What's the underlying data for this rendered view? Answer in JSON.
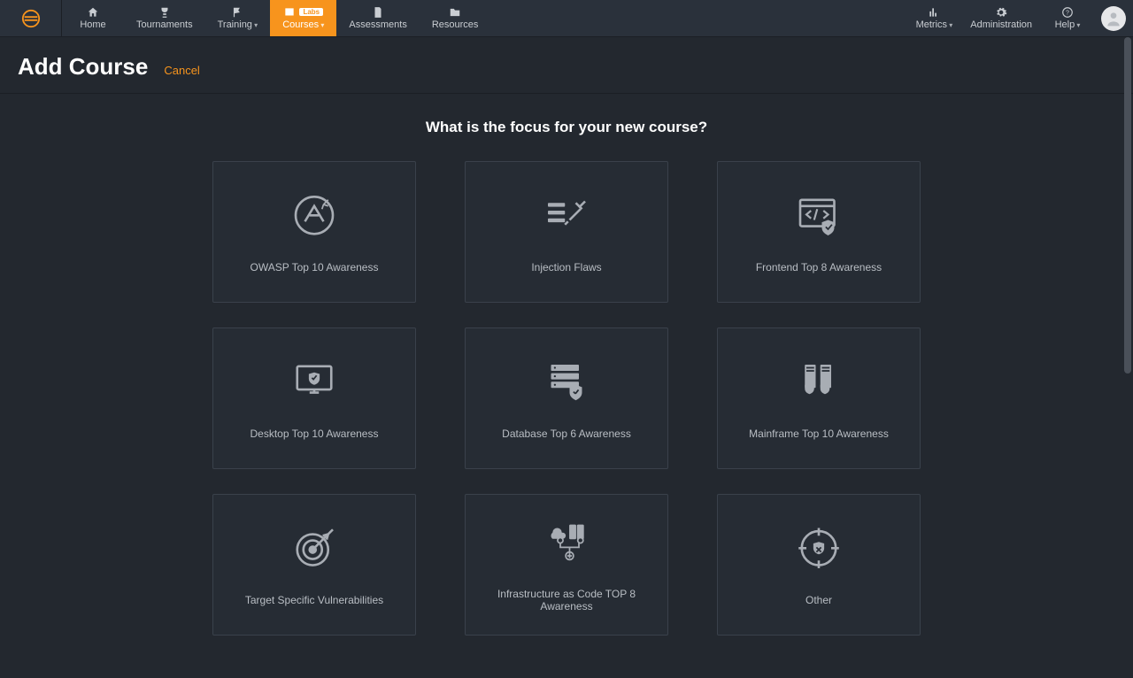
{
  "nav": {
    "items": [
      {
        "key": "home",
        "label": "Home",
        "dropdown": false
      },
      {
        "key": "tournaments",
        "label": "Tournaments",
        "dropdown": false
      },
      {
        "key": "training",
        "label": "Training",
        "dropdown": true
      },
      {
        "key": "courses",
        "label": "Courses",
        "dropdown": true,
        "active": true,
        "badge": "Labs"
      },
      {
        "key": "assessments",
        "label": "Assessments",
        "dropdown": false
      },
      {
        "key": "resources",
        "label": "Resources",
        "dropdown": false
      }
    ],
    "right": [
      {
        "key": "metrics",
        "label": "Metrics",
        "dropdown": true
      },
      {
        "key": "administration",
        "label": "Administration",
        "dropdown": false
      },
      {
        "key": "help",
        "label": "Help",
        "dropdown": true
      }
    ]
  },
  "page": {
    "title": "Add Course",
    "cancel": "Cancel",
    "prompt": "What is the focus for your new course?"
  },
  "cards": [
    {
      "key": "owasp",
      "label": "OWASP Top 10 Awareness"
    },
    {
      "key": "injection",
      "label": "Injection Flaws"
    },
    {
      "key": "frontend",
      "label": "Frontend Top 8 Awareness"
    },
    {
      "key": "desktop",
      "label": "Desktop Top 10 Awareness"
    },
    {
      "key": "database",
      "label": "Database Top 6 Awareness"
    },
    {
      "key": "mainframe",
      "label": "Mainframe Top 10 Awareness"
    },
    {
      "key": "target",
      "label": "Target Specific Vulnerabilities"
    },
    {
      "key": "iac",
      "label": "Infrastructure as Code TOP 8 Awareness"
    },
    {
      "key": "other",
      "label": "Other"
    }
  ]
}
